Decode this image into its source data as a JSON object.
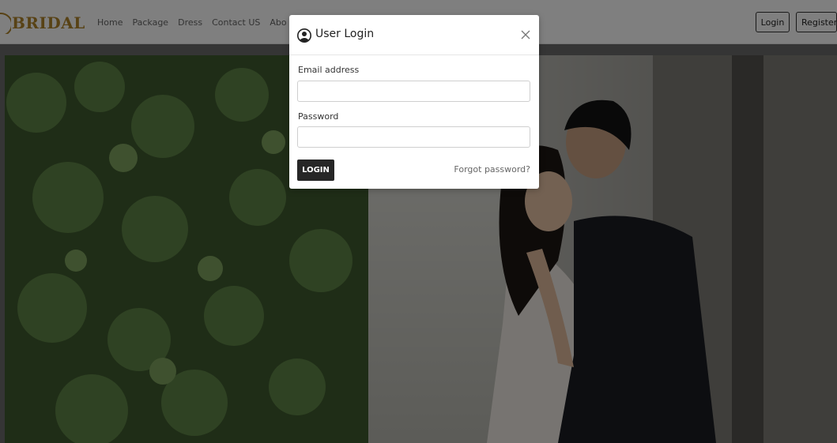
{
  "brand": {
    "name": "BRIDAL",
    "color": "#b0852b"
  },
  "nav": {
    "links": [
      "Home",
      "Package",
      "Dress",
      "Contact US",
      "Abo"
    ],
    "login_label": "Login",
    "register_label": "Register"
  },
  "modal": {
    "title": "User Login",
    "icon": "user-circle-icon",
    "email_label": "Email address",
    "email_value": "",
    "password_label": "Password",
    "password_value": "",
    "submit_label": "LOGIN",
    "forgot_label": "Forgot password?",
    "close_icon": "close-icon"
  },
  "hero": {
    "image": "couple-waterfall-photo"
  },
  "colors": {
    "accent": "#b0852b",
    "button_dark": "#262626",
    "backdrop": "rgba(0,0,0,0.5)"
  }
}
